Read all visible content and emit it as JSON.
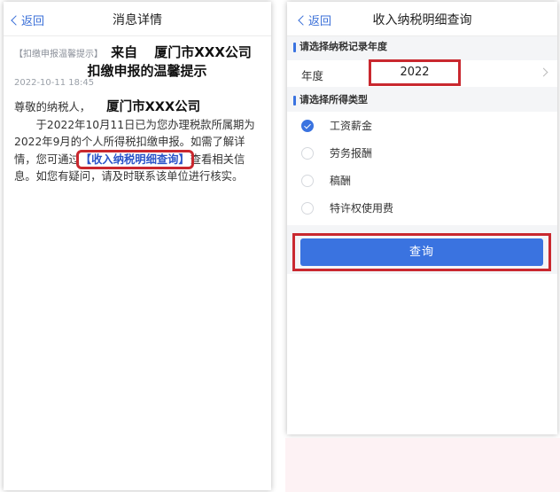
{
  "left": {
    "nav": {
      "back_label": "返回",
      "title": "消息详情"
    },
    "message": {
      "tag": "【扣缴申报温馨提示】",
      "from_prefix": "来自",
      "company": "厦门市XXX公司",
      "title_line2": "扣缴申报的温馨提示",
      "date": "2022-10-11 18:45",
      "greeting": "尊敬的纳税人，",
      "greeting_company": "厦门市XXX公司",
      "body_part1": "于2022年10月11日已为您办理税款所属期为2022年9月的个人所得税扣缴申报。如需了解详情，您可通过",
      "link_text": "【收入纳税明细查询】",
      "body_part2": "查看相关信息。如您有疑问，请及时联系该单位进行核实。"
    }
  },
  "right": {
    "nav": {
      "back_label": "返回",
      "title": "收入纳税明细查询"
    },
    "year_section_label": "请选择纳税记录年度",
    "year_label": "年度",
    "year_value": "2022",
    "type_section_label": "请选择所得类型",
    "income_types": [
      {
        "label": "工资薪金",
        "selected": true
      },
      {
        "label": "劳务报酬",
        "selected": false
      },
      {
        "label": "稿酬",
        "selected": false
      },
      {
        "label": "特许权使用费",
        "selected": false
      }
    ],
    "query_button": "查询",
    "accent_color": "#3a73e0",
    "highlight_color": "#c9282f"
  }
}
